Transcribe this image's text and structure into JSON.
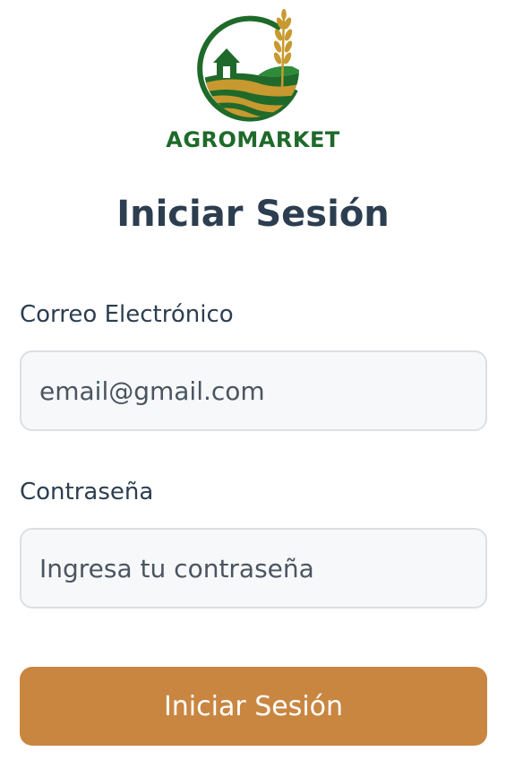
{
  "logo": {
    "text": "AGROMARKET",
    "icon": "farm-wheat-logo",
    "colors": {
      "green": "#1f6a2a",
      "gold": "#c7992f"
    }
  },
  "form": {
    "title": "Iniciar Sesión",
    "email": {
      "label": "Correo Electrónico",
      "value": "",
      "placeholder": "email@gmail.com"
    },
    "password": {
      "label": "Contraseña",
      "value": "",
      "placeholder": "Ingresa tu contraseña"
    },
    "submit_label": "Iniciar Sesión"
  },
  "colors": {
    "title_text": "#2c3e50",
    "button_bg": "#c98641",
    "input_bg": "#f7f8fa",
    "input_border": "#dcdfe3"
  }
}
